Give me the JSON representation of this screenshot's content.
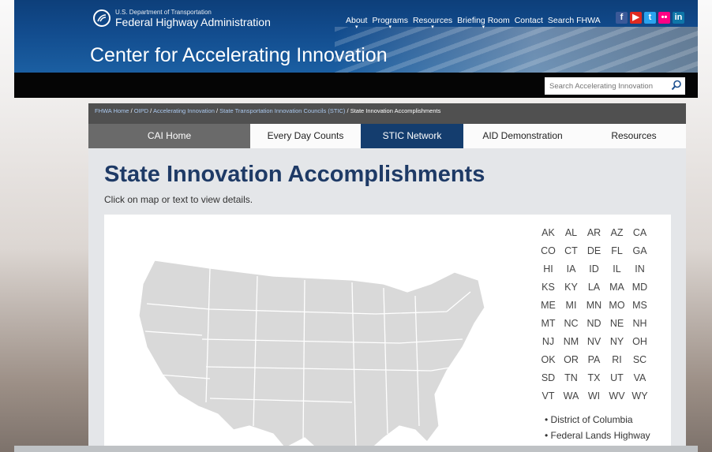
{
  "header": {
    "dept": "U.S. Department of Transportation",
    "agency": "Federal Highway Administration",
    "nav": [
      "About",
      "Programs",
      "Resources",
      "Briefing Room",
      "Contact",
      "Search FHWA"
    ],
    "social": [
      {
        "name": "facebook-icon",
        "glyph": "f",
        "color": "#3b5998"
      },
      {
        "name": "youtube-icon",
        "glyph": "▶",
        "color": "#e02a20"
      },
      {
        "name": "twitter-icon",
        "glyph": "t",
        "color": "#2aa3ef"
      },
      {
        "name": "flickr-icon",
        "glyph": "••",
        "color": "#ff0084"
      },
      {
        "name": "linkedin-icon",
        "glyph": "in",
        "color": "#0e76a8"
      }
    ],
    "site_title": "Center for Accelerating Innovation"
  },
  "search": {
    "placeholder": "Search Accelerating Innovation"
  },
  "breadcrumb": {
    "links": [
      "FHWA Home",
      "OIPD",
      "Accelerating Innovation",
      "State Transportation Innovation Councils (STIC)"
    ],
    "current": "State Innovation Accomplishments"
  },
  "tabs": [
    {
      "label": "CAI Home"
    },
    {
      "label": "Every Day Counts"
    },
    {
      "label": "STIC Network"
    },
    {
      "label": "AID Demonstration"
    },
    {
      "label": "Resources"
    }
  ],
  "main": {
    "title": "State Innovation Accomplishments",
    "instructions": "Click on map or text to view details."
  },
  "states": [
    "AK",
    "AL",
    "AR",
    "AZ",
    "CA",
    "CO",
    "CT",
    "DE",
    "FL",
    "GA",
    "HI",
    "IA",
    "ID",
    "IL",
    "IN",
    "KS",
    "KY",
    "LA",
    "MA",
    "MD",
    "ME",
    "MI",
    "MN",
    "MO",
    "MS",
    "MT",
    "NC",
    "ND",
    "NE",
    "NH",
    "NJ",
    "NM",
    "NV",
    "NY",
    "OH",
    "OK",
    "OR",
    "PA",
    "RI",
    "SC",
    "SD",
    "TN",
    "TX",
    "UT",
    "VA",
    "VT",
    "WA",
    "WI",
    "WV",
    "WY"
  ],
  "extra_links": [
    "District of Columbia",
    "Federal Lands Highway"
  ],
  "colors": {
    "header_blue": "#124c8e",
    "title_blue": "#1e3a66",
    "active_tab": "#143d6e",
    "map_fill": "#d9d9d9"
  }
}
